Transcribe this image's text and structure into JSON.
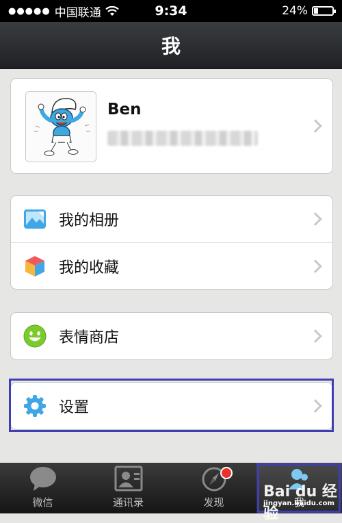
{
  "status_bar": {
    "signal": "●●●●●",
    "carrier": "中国联通",
    "wifi_icon": "wifi-icon",
    "time": "9:34",
    "battery_percent": "24%",
    "battery_level": 0.24
  },
  "nav": {
    "title": "我"
  },
  "profile": {
    "name": "Ben",
    "avatar_icon": "smurf-avatar"
  },
  "menu_group_1": [
    {
      "label": "我的相册",
      "icon": "photo-album-icon"
    },
    {
      "label": "我的收藏",
      "icon": "favorites-cube-icon"
    }
  ],
  "menu_group_2": [
    {
      "label": "表情商店",
      "icon": "smiley-icon"
    }
  ],
  "menu_group_3": [
    {
      "label": "设置",
      "icon": "gear-icon"
    }
  ],
  "tab_bar": {
    "tabs": [
      {
        "label": "微信",
        "icon": "chat-bubble-icon"
      },
      {
        "label": "通讯录",
        "icon": "contacts-card-icon"
      },
      {
        "label": "发现",
        "icon": "compass-icon"
      },
      {
        "label": "我",
        "icon": "person-icon"
      }
    ],
    "active": "我"
  },
  "watermark": {
    "brand": "Bai du 经验",
    "site": "jingyan.baidu.com"
  },
  "colors": {
    "highlight": "#3f3fb4",
    "nav_bg": "#2b2d30",
    "badge": "#e8322c",
    "page_bg": "#e6e6e4"
  }
}
